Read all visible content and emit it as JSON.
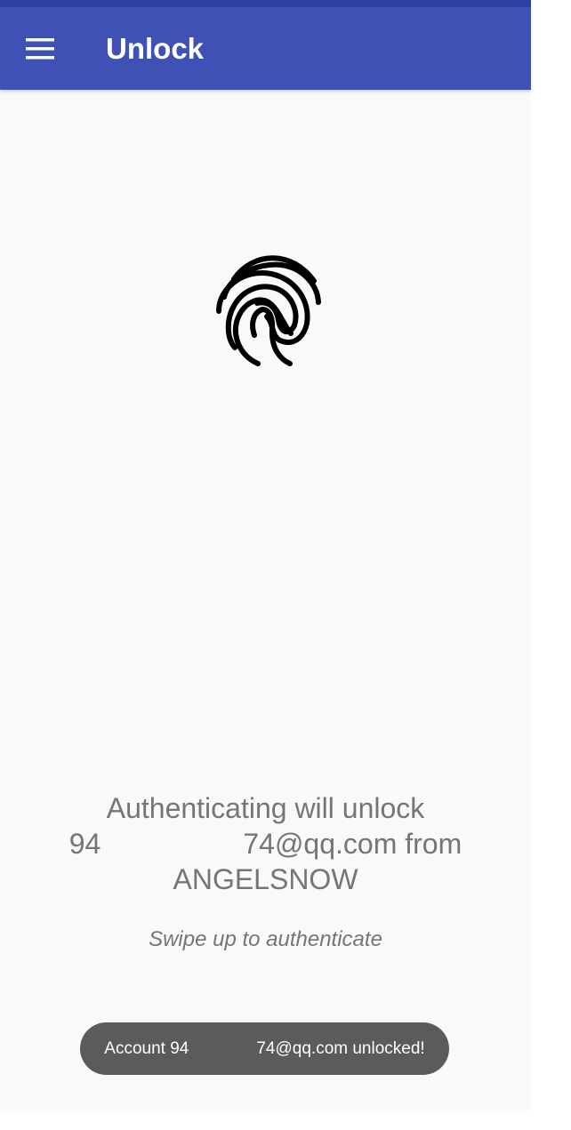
{
  "app_bar": {
    "title": "Unlock",
    "menu_icon": "hamburger-menu-icon",
    "color": "#3f51b5",
    "status_color": "#303f9f"
  },
  "fingerprint": {
    "icon": "fingerprint-icon",
    "color": "#000000"
  },
  "message": {
    "text": "Authenticating will unlock\n94     74@qq.com from\nANGELSNOW"
  },
  "hint": {
    "text": "Swipe up to authenticate"
  },
  "toast": {
    "text": "Account 94    74@qq.com unlocked!",
    "color": "#5b5b5b"
  }
}
